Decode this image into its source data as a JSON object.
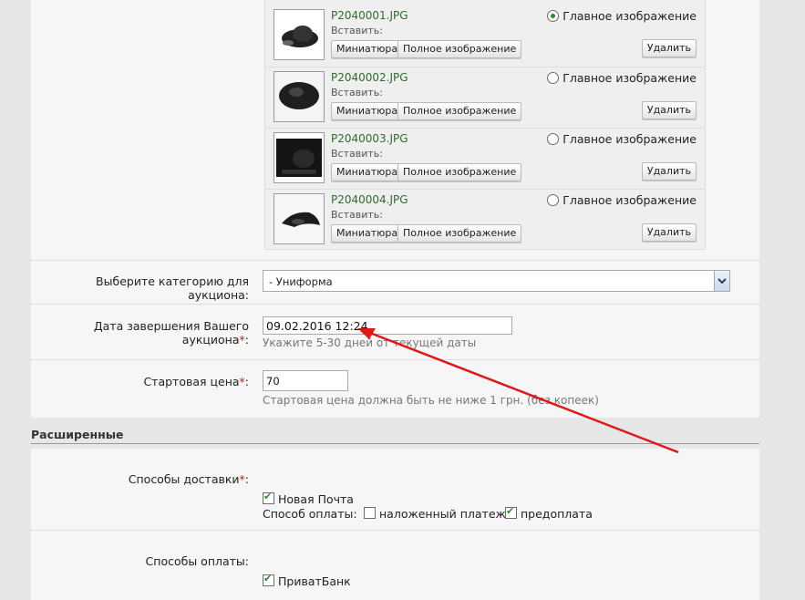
{
  "images": {
    "insert_label": "Вставить:",
    "thumb_button": "Миниатюра",
    "full_button": "Полное изображение",
    "delete_button": "Удалить",
    "main_image_label": "Главное изображение",
    "items": [
      {
        "filename": "P2040001.JPG",
        "is_main": true
      },
      {
        "filename": "P2040002.JPG",
        "is_main": false
      },
      {
        "filename": "P2040003.JPG",
        "is_main": false
      },
      {
        "filename": "P2040004.JPG",
        "is_main": false
      }
    ]
  },
  "category": {
    "label": "Выберите категорию для аукциона:",
    "selected": "- Униформа"
  },
  "end_date": {
    "label": "Дата завершения Вашего аукциона",
    "required_mark": "*",
    "colon": ":",
    "value": "09.02.2016 12:24",
    "hint": "Укажите 5-30 дней от текущей даты"
  },
  "start_price": {
    "label": "Стартовая цена",
    "required_mark": "*",
    "colon": ":",
    "value": "70",
    "hint": "Стартовая цена должна быть не ниже 1 грн. (без копеек)"
  },
  "advanced": {
    "title": "Расширенные"
  },
  "delivery": {
    "label": "Способы доставки",
    "required_mark": "*",
    "colon": ":",
    "option_nova_poshta": "Новая Почта",
    "payment_method_label": "Способ оплаты:",
    "option_cod": "наложенный платеж",
    "option_prepay": "предоплата",
    "nova_poshta_checked": true,
    "cod_checked": false,
    "prepay_checked": true
  },
  "payment": {
    "label": "Способы оплаты:",
    "option_privat": "ПриватБанк",
    "privat_checked": true
  },
  "colors": {
    "annotation_arrow": "#e01818",
    "filename_green": "#2f6a2f"
  }
}
